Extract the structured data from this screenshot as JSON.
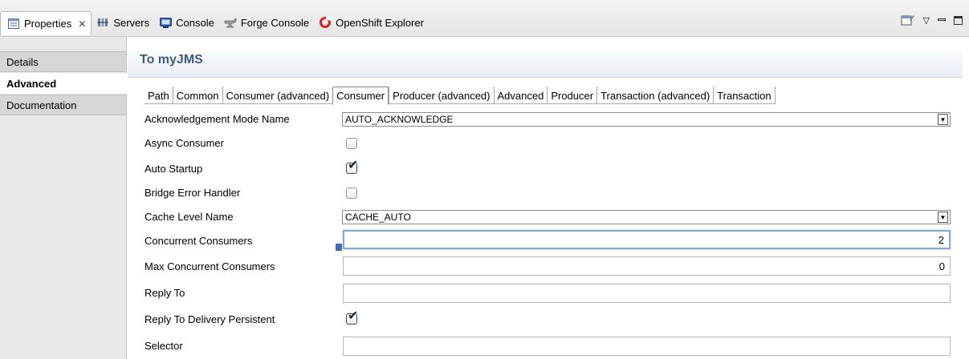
{
  "view_tabs": [
    {
      "label": "Properties",
      "icon": "properties-icon",
      "active": true
    },
    {
      "label": "Servers",
      "icon": "servers-icon"
    },
    {
      "label": "Console",
      "icon": "console-icon"
    },
    {
      "label": "Forge Console",
      "icon": "forge-icon"
    },
    {
      "label": "OpenShift Explorer",
      "icon": "openshift-icon"
    }
  ],
  "close_glyph": "✕",
  "view_controls": {
    "new_view": "new-view-icon",
    "menu": "▽",
    "minimize": "▭",
    "maximize": "☐"
  },
  "sidebar": {
    "items": [
      {
        "label": "Details"
      },
      {
        "label": "Advanced"
      },
      {
        "label": "Documentation"
      }
    ]
  },
  "header": {
    "title": "To myJMS"
  },
  "subtabs": [
    "Path",
    "Common",
    "Consumer (advanced)",
    "Consumer",
    "Producer (advanced)",
    "Advanced",
    "Producer",
    "Transaction (advanced)",
    "Transaction"
  ],
  "active_subtab": "Consumer",
  "fields": {
    "ack_mode": {
      "label": "Acknowledgement Mode Name",
      "value": "AUTO_ACKNOWLEDGE"
    },
    "async_consumer": {
      "label": "Async Consumer",
      "checked": false
    },
    "auto_startup": {
      "label": "Auto Startup",
      "checked": true
    },
    "bridge_error": {
      "label": "Bridge Error Handler",
      "checked": false
    },
    "cache_level": {
      "label": "Cache Level Name",
      "value": "CACHE_AUTO"
    },
    "concurrent": {
      "label": "Concurrent Consumers",
      "value": "2"
    },
    "max_concurrent": {
      "label": "Max Concurrent Consumers",
      "value": "0"
    },
    "reply_to": {
      "label": "Reply To",
      "value": ""
    },
    "reply_persistent": {
      "label": "Reply To Delivery Persistent",
      "checked": true
    },
    "selector": {
      "label": "Selector",
      "value": ""
    }
  },
  "dropdown_arrow": "▼",
  "check_glyph": "✔"
}
